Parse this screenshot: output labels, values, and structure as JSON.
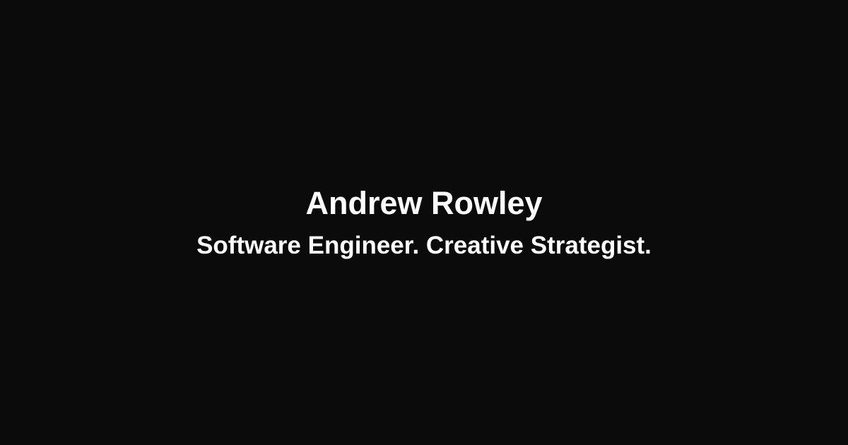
{
  "card": {
    "name": "Andrew Rowley",
    "tagline": "Software Engineer. Creative Strategist."
  },
  "colors": {
    "background": "#0b0b0c",
    "text": "#ffffff"
  }
}
